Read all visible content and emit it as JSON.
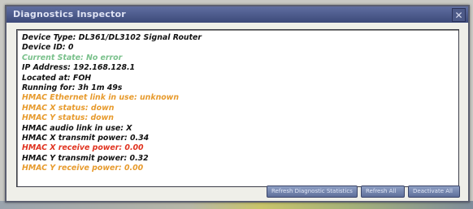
{
  "window": {
    "title": "Diagnostics Inspector",
    "close_glyph": "✕"
  },
  "info_lines": [
    {
      "text": "Device Type: DL361/DL3102 Signal Router",
      "color": "black"
    },
    {
      "text": "Device ID: 0",
      "color": "black"
    },
    {
      "text": "Current State: No error",
      "color": "green"
    },
    {
      "text": "IP Address: 192.168.128.1",
      "color": "black"
    },
    {
      "text": "Located at: FOH",
      "color": "black"
    },
    {
      "text": "Running for: 3h 1m 49s",
      "color": "black"
    },
    {
      "text": "HMAC Ethernet link in use: unknown",
      "color": "orange"
    },
    {
      "text": "HMAC X status: down",
      "color": "orange"
    },
    {
      "text": "HMAC Y status: down",
      "color": "orange"
    },
    {
      "text": "HMAC audio link in use: X",
      "color": "black"
    },
    {
      "text": "HMAC X transmit power: 0.34",
      "color": "black"
    },
    {
      "text": "HMAC X receive power: 0.00",
      "color": "red"
    },
    {
      "text": "HMAC Y transmit power: 0.32",
      "color": "black"
    },
    {
      "text": "HMAC Y receive power: 0.00",
      "color": "orange"
    }
  ],
  "colors": {
    "black": "#111111",
    "green": "#78c08a",
    "orange": "#e79a2c",
    "red": "#e0321e",
    "titlebar": "#4a5786"
  },
  "buttons": {
    "b1_label": "Refresh Diagnostic Statistics",
    "b2_label": "Refresh All",
    "b3_label": "Deactivate All"
  }
}
